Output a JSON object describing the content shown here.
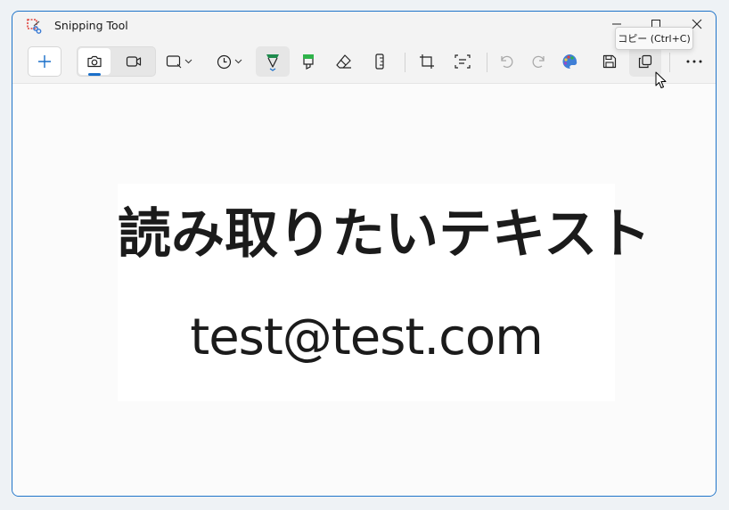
{
  "window": {
    "title": "Snipping Tool"
  },
  "toolbar": {
    "new_icon": "plus-icon",
    "mode_photo_icon": "camera-icon",
    "mode_video_icon": "video-camera-icon",
    "snip_shape_icon": "rectangle-snip-icon",
    "timer_icon": "clock-icon",
    "pen_icon": "ballpoint-pen-icon",
    "highlighter_icon": "highlighter-icon",
    "eraser_icon": "eraser-icon",
    "ruler_icon": "ruler-icon",
    "crop_icon": "crop-icon",
    "text_actions_icon": "text-actions-icon",
    "undo_icon": "undo-icon",
    "redo_icon": "redo-icon",
    "paint_icon": "paint-app-icon",
    "save_icon": "save-icon",
    "copy_icon": "copy-icon",
    "more_icon": "more-icon"
  },
  "tooltip": {
    "copy": "コピー (Ctrl+C)"
  },
  "snip": {
    "japanese_text": "読み取りたいテキスト",
    "email_text": "test@test.com"
  },
  "colors": {
    "accent": "#1a6fc9",
    "pen": "#1e8a4d",
    "highlighter": "#2fb34a",
    "window_border": "#1f74c9"
  }
}
